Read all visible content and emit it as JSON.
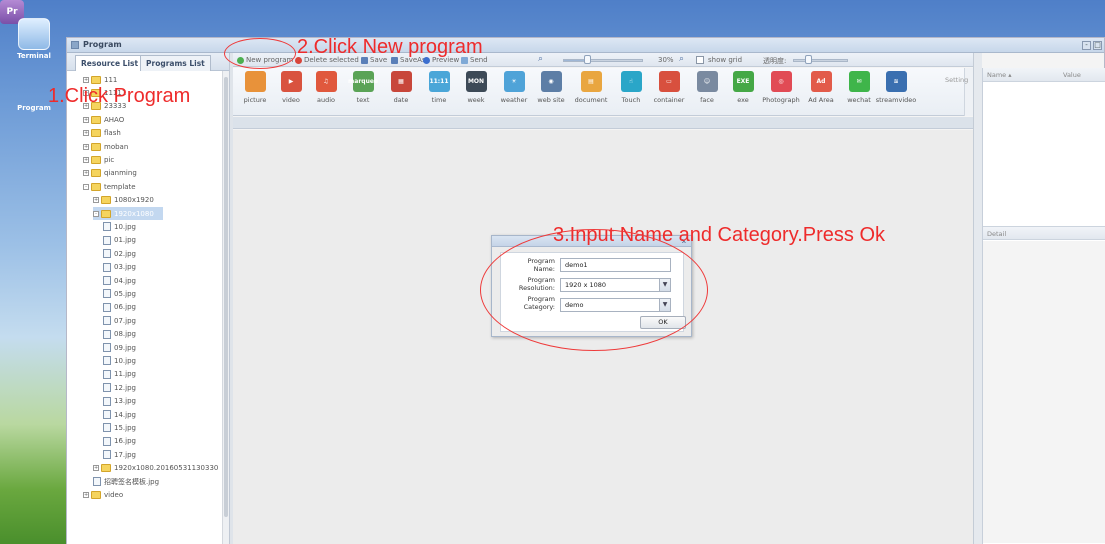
{
  "launcher": {
    "terminal_label": "Terminal",
    "program_icon_text": "Pr",
    "program_label": "Program"
  },
  "window": {
    "title": "Program",
    "minimize": "-",
    "maximize": "□"
  },
  "left_panel": {
    "tabs": [
      "Resource List",
      "Programs List"
    ],
    "tree": [
      {
        "label": "111",
        "indent": 1,
        "type": "folder",
        "expand": "+"
      },
      {
        "label": "11111",
        "indent": 1,
        "type": "folder",
        "expand": "+"
      },
      {
        "label": "23333",
        "indent": 1,
        "type": "folder",
        "expand": "+"
      },
      {
        "label": "AHAO",
        "indent": 1,
        "type": "folder",
        "expand": "+"
      },
      {
        "label": "flash",
        "indent": 1,
        "type": "folder",
        "expand": "+"
      },
      {
        "label": "moban",
        "indent": 1,
        "type": "folder",
        "expand": "+"
      },
      {
        "label": "pic",
        "indent": 1,
        "type": "folder",
        "expand": "+"
      },
      {
        "label": "qianming",
        "indent": 1,
        "type": "folder",
        "expand": "+"
      },
      {
        "label": "template",
        "indent": 1,
        "type": "folder",
        "expand": "-"
      },
      {
        "label": "1080x1920",
        "indent": 2,
        "type": "folder",
        "expand": "+"
      },
      {
        "label": "1920x1080",
        "indent": 2,
        "type": "folder",
        "expand": "-",
        "selected": true
      },
      {
        "label": "10.jpg",
        "indent": 3,
        "type": "file"
      },
      {
        "label": "01.jpg",
        "indent": 3,
        "type": "file"
      },
      {
        "label": "02.jpg",
        "indent": 3,
        "type": "file"
      },
      {
        "label": "03.jpg",
        "indent": 3,
        "type": "file"
      },
      {
        "label": "04.jpg",
        "indent": 3,
        "type": "file"
      },
      {
        "label": "05.jpg",
        "indent": 3,
        "type": "file"
      },
      {
        "label": "06.jpg",
        "indent": 3,
        "type": "file"
      },
      {
        "label": "07.jpg",
        "indent": 3,
        "type": "file"
      },
      {
        "label": "08.jpg",
        "indent": 3,
        "type": "file"
      },
      {
        "label": "09.jpg",
        "indent": 3,
        "type": "file"
      },
      {
        "label": "10.jpg",
        "indent": 3,
        "type": "file"
      },
      {
        "label": "11.jpg",
        "indent": 3,
        "type": "file"
      },
      {
        "label": "12.jpg",
        "indent": 3,
        "type": "file"
      },
      {
        "label": "13.jpg",
        "indent": 3,
        "type": "file"
      },
      {
        "label": "14.jpg",
        "indent": 3,
        "type": "file"
      },
      {
        "label": "15.jpg",
        "indent": 3,
        "type": "file"
      },
      {
        "label": "16.jpg",
        "indent": 3,
        "type": "file"
      },
      {
        "label": "17.jpg",
        "indent": 3,
        "type": "file"
      },
      {
        "label": "1920x1080.20160531130330",
        "indent": 2,
        "type": "folder",
        "expand": "+"
      },
      {
        "label": "招聘签名模板.jpg",
        "indent": 2,
        "type": "file"
      },
      {
        "label": "video",
        "indent": 1,
        "type": "folder",
        "expand": "+"
      }
    ]
  },
  "toolbar": {
    "new_program": "New program",
    "delete_selected": "Delete selected",
    "save": "Save",
    "saveas": "SaveAs",
    "preview": "Preview",
    "send": "Send",
    "zoom_percent": "30%",
    "zoom_fraction": 0.3,
    "show_grid": "show grid",
    "opacity_label": "透明度:"
  },
  "widgets": [
    {
      "label": "picture",
      "color": "#e8923a",
      "glyph": ""
    },
    {
      "label": "video",
      "color": "#d9533f",
      "glyph": "▶"
    },
    {
      "label": "audio",
      "color": "#e0583d",
      "glyph": "♫"
    },
    {
      "label": "text",
      "color": "#5aa356",
      "glyph": "marquee"
    },
    {
      "label": "date",
      "color": "#c8473b",
      "glyph": "▦"
    },
    {
      "label": "time",
      "color": "#4aa6d8",
      "glyph": "11:11"
    },
    {
      "label": "week",
      "color": "#3d4a57",
      "glyph": "MON"
    },
    {
      "label": "weather",
      "color": "#4fa3d8",
      "glyph": "☀"
    },
    {
      "label": "web site",
      "color": "#5d7ea6",
      "glyph": "◉"
    },
    {
      "label": "document",
      "color": "#e9a640",
      "glyph": "▤"
    },
    {
      "label": "Touch",
      "color": "#2aa6c8",
      "glyph": "☝"
    },
    {
      "label": "container",
      "color": "#d8503e",
      "glyph": "▭"
    },
    {
      "label": "face",
      "color": "#7a8aa0",
      "glyph": "☺"
    },
    {
      "label": "exe",
      "color": "#45a846",
      "glyph": "EXE"
    },
    {
      "label": "Photograph",
      "color": "#e14b55",
      "glyph": "◎"
    },
    {
      "label": "Ad Area",
      "color": "#e25b4a",
      "glyph": "Ad"
    },
    {
      "label": "wechat",
      "color": "#3fb54a",
      "glyph": "✉"
    },
    {
      "label": "streamvideo",
      "color": "#3a6fb0",
      "glyph": "≋"
    }
  ],
  "right_panel": {
    "setting": "Setting",
    "name_col": "Name ▴",
    "value_col": "Value",
    "detail": "Detail"
  },
  "dialog": {
    "close": "x",
    "name_label": "Program Name:",
    "name_value": "demo1",
    "resolution_label": "Program Resolution:",
    "resolution_value": "1920 x 1080",
    "category_label": "Program Category:",
    "category_value": "demo",
    "ok": "OK"
  },
  "annotations": {
    "step1": "1.Click Program",
    "step2": "2.Click New program",
    "step3": "3.Input Name and Category.Press Ok",
    "color": "#ee2b2b"
  }
}
